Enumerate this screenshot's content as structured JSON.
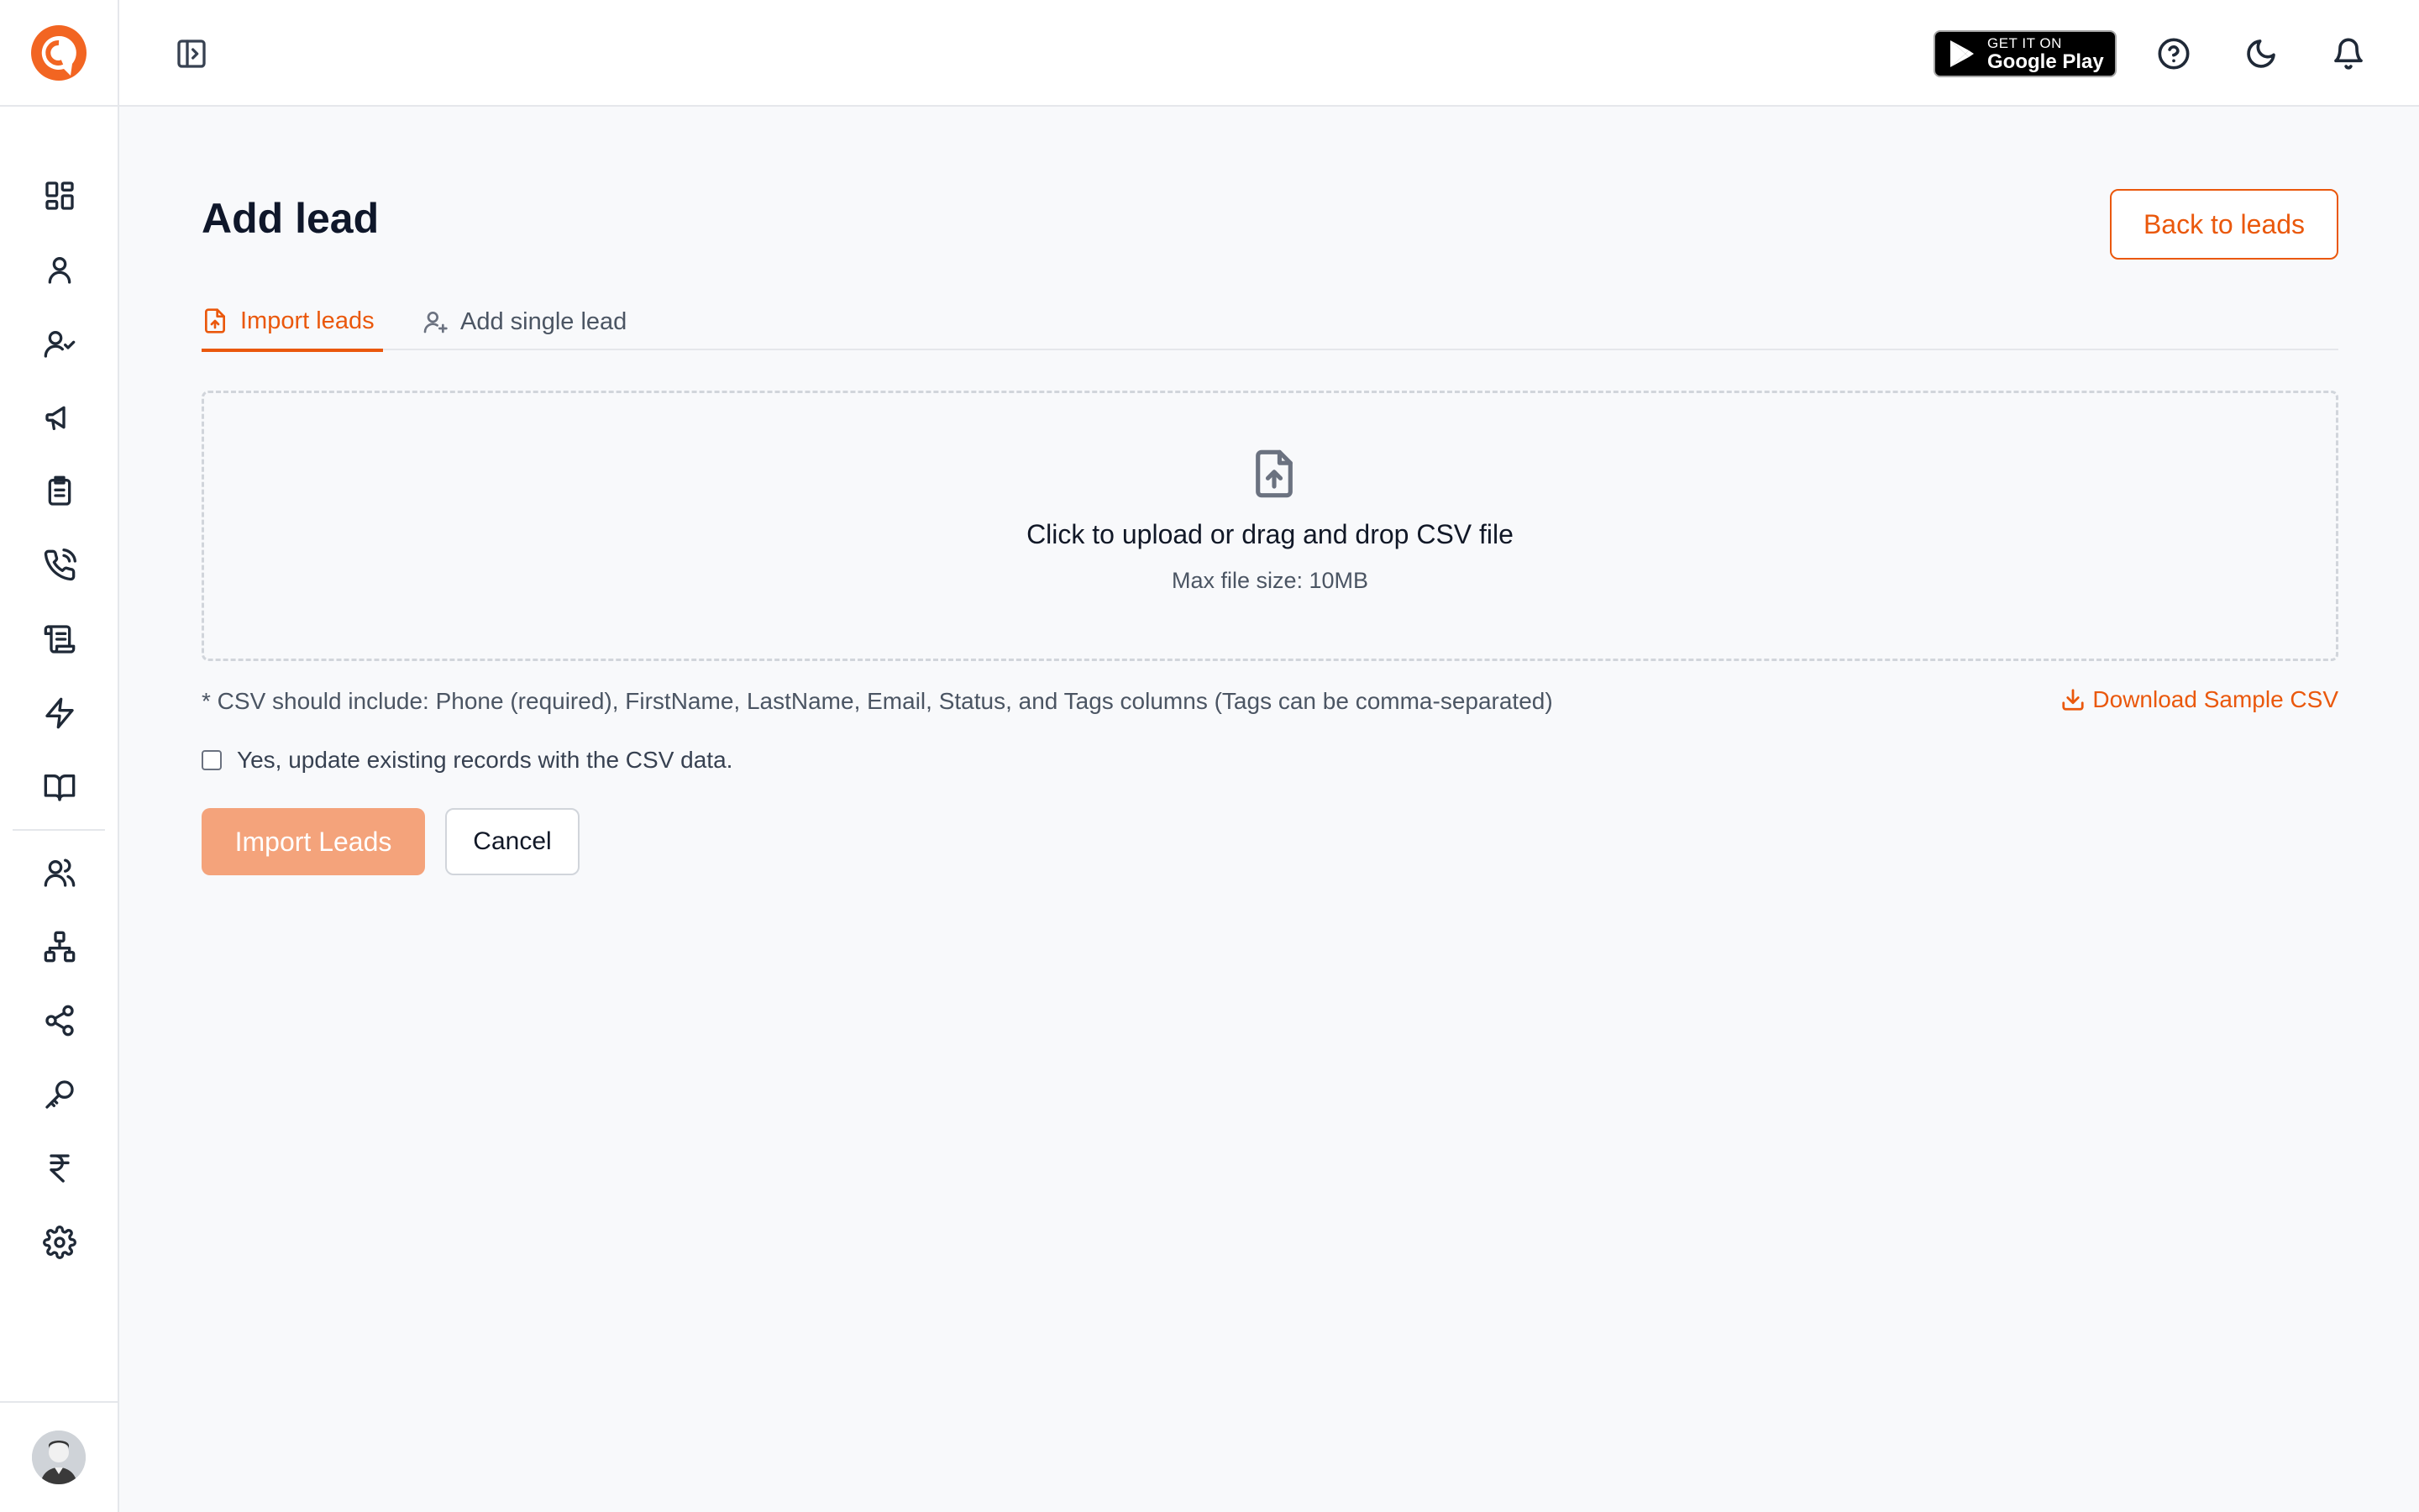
{
  "brand": {
    "accent": "#ea580c",
    "accent_light": "#f4a37b",
    "logo_icon": "brand-logo-icon"
  },
  "sidebar": {
    "items": [
      {
        "name": "dashboard-icon"
      },
      {
        "name": "user-icon"
      },
      {
        "name": "user-check-icon"
      },
      {
        "name": "megaphone-icon"
      },
      {
        "name": "clipboard-list-icon"
      },
      {
        "name": "phone-call-icon"
      },
      {
        "name": "scroll-icon"
      },
      {
        "name": "zap-icon"
      },
      {
        "name": "book-open-icon"
      }
    ],
    "items_secondary": [
      {
        "name": "users-icon"
      },
      {
        "name": "network-icon"
      },
      {
        "name": "share-icon"
      },
      {
        "name": "key-icon"
      },
      {
        "name": "rupee-icon"
      },
      {
        "name": "settings-icon"
      }
    ]
  },
  "topbar": {
    "google_play": {
      "small": "GET IT ON",
      "big": "Google Play"
    }
  },
  "page": {
    "title": "Add lead",
    "back_button": "Back to leads",
    "tabs": [
      {
        "label": "Import leads",
        "active": true
      },
      {
        "label": "Add single lead",
        "active": false
      }
    ],
    "dropzone": {
      "title": "Click to upload or drag and drop CSV file",
      "subtitle": "Max file size: 10MB"
    },
    "note": "* CSV should include: Phone (required), FirstName, LastName, Email, Status, and Tags columns (Tags can be comma-separated)",
    "download_link": "Download Sample CSV",
    "checkbox_label": "Yes, update existing records with the CSV data.",
    "checkbox_checked": false,
    "import_button": "Import Leads",
    "cancel_button": "Cancel"
  }
}
